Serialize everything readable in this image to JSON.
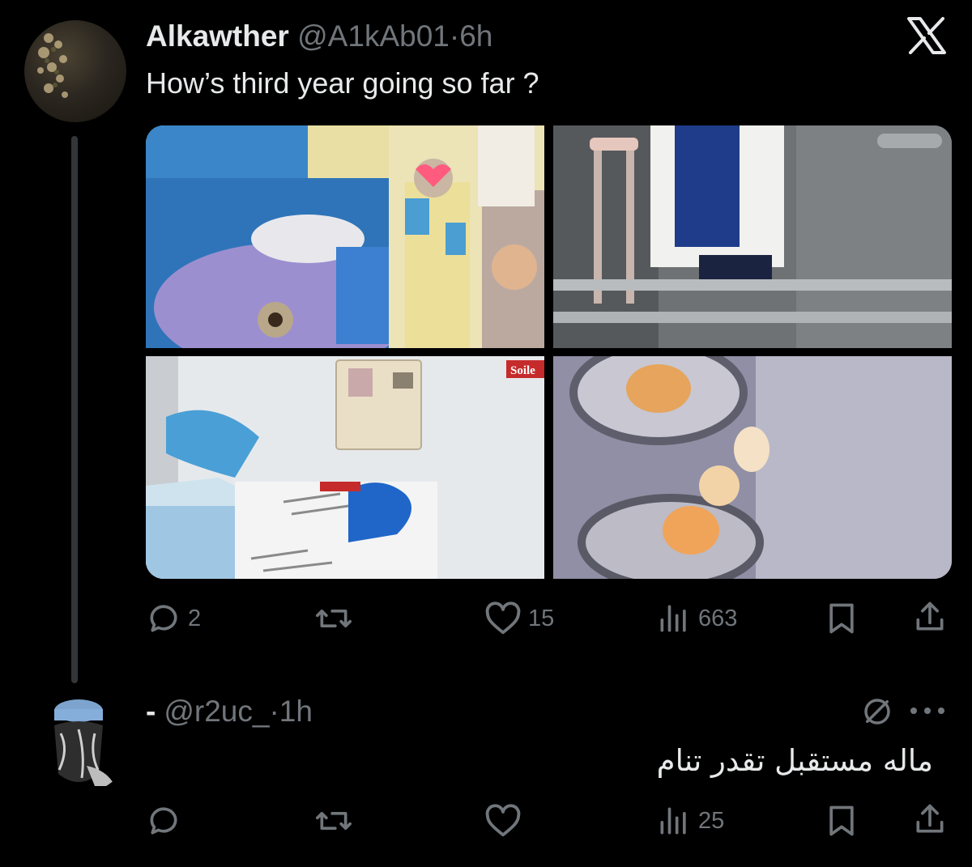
{
  "tweet": {
    "display_name": "Alkawther",
    "handle": "@A1kAb01",
    "separator": "·",
    "time": "6h",
    "text": "How’s third year going so far ?",
    "media_sign_text": "Soile",
    "actions": {
      "replies": "2",
      "retweets": "",
      "likes": "15",
      "views": "663"
    }
  },
  "reply": {
    "display_name": "-",
    "handle": "@r2uc_",
    "separator": "·",
    "time": "1h",
    "text": "ماله مستقبل تقدر تنام",
    "actions": {
      "replies": "",
      "retweets": "",
      "likes": "",
      "views": "25"
    }
  },
  "icons": {
    "brand": "x-logo",
    "reply": "reply-icon",
    "retweet": "retweet-icon",
    "like": "heart-icon",
    "views": "views-icon",
    "bookmark": "bookmark-icon",
    "share": "share-icon",
    "more": "more-icon",
    "restricted": "no-entry-icon"
  },
  "colors": {
    "background": "#000000",
    "text": "#e7e9ea",
    "muted": "#71767b",
    "thread_line": "#333639"
  }
}
